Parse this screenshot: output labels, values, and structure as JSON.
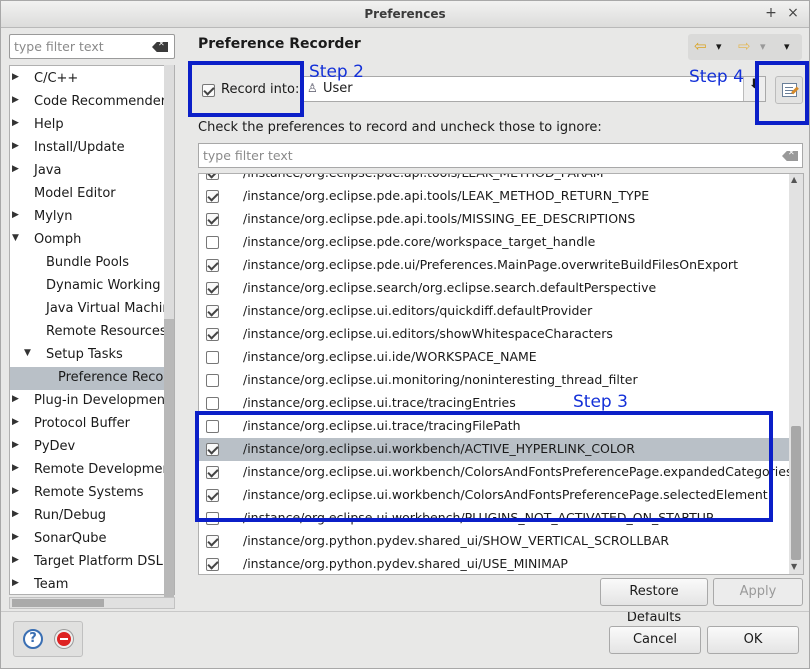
{
  "window": {
    "title": "Preferences"
  },
  "titlebar_buttons": {
    "add": "+",
    "close": "×"
  },
  "left": {
    "filter_placeholder": "type filter text",
    "tree": [
      {
        "label": "C/C++",
        "depth": 0,
        "arrow": "▶"
      },
      {
        "label": "Code Recommenders",
        "depth": 0,
        "arrow": "▶"
      },
      {
        "label": "Help",
        "depth": 0,
        "arrow": "▶"
      },
      {
        "label": "Install/Update",
        "depth": 0,
        "arrow": "▶"
      },
      {
        "label": "Java",
        "depth": 0,
        "arrow": "▶"
      },
      {
        "label": "Model Editor",
        "depth": 0,
        "arrow": ""
      },
      {
        "label": "Mylyn",
        "depth": 0,
        "arrow": "▶"
      },
      {
        "label": "Oomph",
        "depth": 0,
        "arrow": "▼"
      },
      {
        "label": "Bundle Pools",
        "depth": 1,
        "arrow": ""
      },
      {
        "label": "Dynamic Working Sets",
        "depth": 1,
        "arrow": ""
      },
      {
        "label": "Java Virtual Machines",
        "depth": 1,
        "arrow": ""
      },
      {
        "label": "Remote Resources",
        "depth": 1,
        "arrow": ""
      },
      {
        "label": "Setup Tasks",
        "depth": 1,
        "arrow": "▼"
      },
      {
        "label": "Preference Recorder",
        "depth": 2,
        "arrow": "",
        "selected": true
      },
      {
        "label": "Plug-in Development",
        "depth": 0,
        "arrow": "▶"
      },
      {
        "label": "Protocol Buffer",
        "depth": 0,
        "arrow": "▶"
      },
      {
        "label": "PyDev",
        "depth": 0,
        "arrow": "▶"
      },
      {
        "label": "Remote Development",
        "depth": 0,
        "arrow": "▶"
      },
      {
        "label": "Remote Systems",
        "depth": 0,
        "arrow": "▶"
      },
      {
        "label": "Run/Debug",
        "depth": 0,
        "arrow": "▶"
      },
      {
        "label": "SonarQube",
        "depth": 0,
        "arrow": "▶"
      },
      {
        "label": "Target Platform DSL",
        "depth": 0,
        "arrow": "▶"
      },
      {
        "label": "Team",
        "depth": 0,
        "arrow": "▶"
      }
    ]
  },
  "right": {
    "page_title": "Preference Recorder",
    "nav": {
      "back": "⇦",
      "forward": "⇨",
      "menu": "▾"
    },
    "record_into_label": "Record into:",
    "record_into_checked": true,
    "record_into_value": "User",
    "instructions": "Check the preferences to record and uncheck those to ignore:",
    "filter_placeholder": "type filter text",
    "preferences": [
      {
        "path": "/instance/org.eclipse.pde.api.tools/LEAK_METHOD_PARAM",
        "checked": true
      },
      {
        "path": "/instance/org.eclipse.pde.api.tools/LEAK_METHOD_RETURN_TYPE",
        "checked": true
      },
      {
        "path": "/instance/org.eclipse.pde.api.tools/MISSING_EE_DESCRIPTIONS",
        "checked": true
      },
      {
        "path": "/instance/org.eclipse.pde.core/workspace_target_handle",
        "checked": false
      },
      {
        "path": "/instance/org.eclipse.pde.ui/Preferences.MainPage.overwriteBuildFilesOnExport",
        "checked": true
      },
      {
        "path": "/instance/org.eclipse.search/org.eclipse.search.defaultPerspective",
        "checked": true
      },
      {
        "path": "/instance/org.eclipse.ui.editors/quickdiff.defaultProvider",
        "checked": true
      },
      {
        "path": "/instance/org.eclipse.ui.editors/showWhitespaceCharacters",
        "checked": true
      },
      {
        "path": "/instance/org.eclipse.ui.ide/WORKSPACE_NAME",
        "checked": false
      },
      {
        "path": "/instance/org.eclipse.ui.monitoring/noninteresting_thread_filter",
        "checked": false
      },
      {
        "path": "/instance/org.eclipse.ui.trace/tracingEntries",
        "checked": false
      },
      {
        "path": "/instance/org.eclipse.ui.trace/tracingFilePath",
        "checked": false
      },
      {
        "path": "/instance/org.eclipse.ui.workbench/ACTIVE_HYPERLINK_COLOR",
        "checked": true,
        "selected": true
      },
      {
        "path": "/instance/org.eclipse.ui.workbench/ColorsAndFontsPreferencePage.expandedCategories",
        "checked": true
      },
      {
        "path": "/instance/org.eclipse.ui.workbench/ColorsAndFontsPreferencePage.selectedElement",
        "checked": true
      },
      {
        "path": "/instance/org.eclipse.ui.workbench/PLUGINS_NOT_ACTIVATED_ON_STARTUP",
        "checked": false
      },
      {
        "path": "/instance/org.python.pydev.shared_ui/SHOW_VERTICAL_SCROLLBAR",
        "checked": true
      },
      {
        "path": "/instance/org.python.pydev.shared_ui/USE_MINIMAP",
        "checked": true
      }
    ],
    "restore_defaults_label": "Restore Defaults",
    "apply_label": "Apply"
  },
  "footer": {
    "cancel_label": "Cancel",
    "ok_label": "OK",
    "help_glyph": "?"
  },
  "annotations": {
    "step2": "Step 2",
    "step3": "Step 3",
    "step4": "Step 4",
    "color": "#0b1fc8"
  }
}
